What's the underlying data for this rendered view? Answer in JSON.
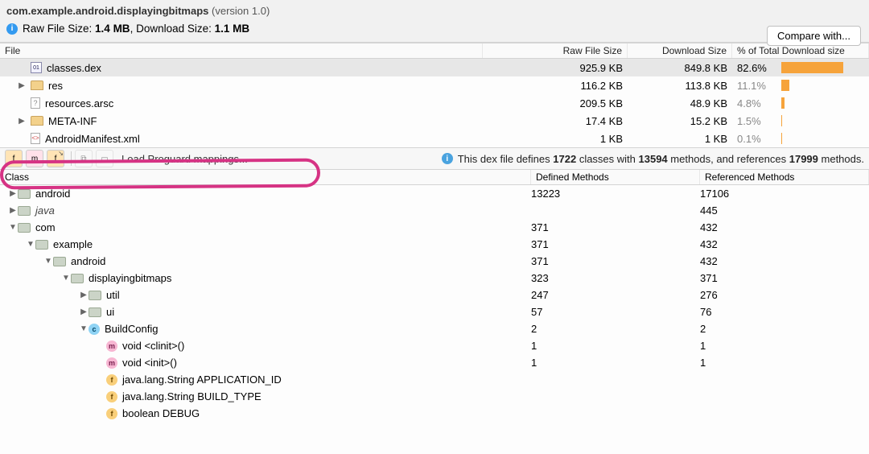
{
  "header": {
    "package": "com.example.android.displayingbitmaps",
    "version_label": "(version 1.0)",
    "raw_label": "Raw File Size:",
    "raw_value": "1.4 MB",
    "dl_label": ", Download Size:",
    "dl_value": "1.1 MB",
    "compare": "Compare with..."
  },
  "file_table": {
    "headers": {
      "file": "File",
      "raw": "Raw File Size",
      "dl": "Download Size",
      "pct": "% of Total Download size"
    },
    "rows": [
      {
        "name": "classes.dex",
        "raw": "925.9 KB",
        "dl": "849.8 KB",
        "pct": "82.6%",
        "bar": 82.6,
        "icon": "dex",
        "arrow": "",
        "selected": true,
        "pad": 26
      },
      {
        "name": "res",
        "raw": "116.2 KB",
        "dl": "113.8 KB",
        "pct": "11.1%",
        "bar": 11.1,
        "icon": "folder",
        "arrow": "▶",
        "pad": 10
      },
      {
        "name": "resources.arsc",
        "raw": "209.5 KB",
        "dl": "48.9 KB",
        "pct": "4.8%",
        "bar": 4.8,
        "icon": "arsc",
        "arrow": "",
        "pad": 26
      },
      {
        "name": "META-INF",
        "raw": "17.4 KB",
        "dl": "15.2 KB",
        "pct": "1.5%",
        "bar": 1.5,
        "icon": "folder",
        "arrow": "▶",
        "pad": 10
      },
      {
        "name": "AndroidManifest.xml",
        "raw": "1 KB",
        "dl": "1 KB",
        "pct": "0.1%",
        "bar": 0.5,
        "icon": "xml",
        "arrow": "",
        "pad": 26
      }
    ]
  },
  "toolbar": {
    "proguard": "Load Proguard mappings...",
    "dex_info_prefix": "This dex file defines",
    "classes": "1722",
    "classes_suffix": "classes with",
    "methods": "13594",
    "methods_suffix": "methods, and references",
    "refs": "17999",
    "refs_suffix": "methods."
  },
  "class_table": {
    "headers": {
      "cls": "Class",
      "def": "Defined Methods",
      "ref": "Referenced Methods"
    },
    "rows": [
      {
        "indent": 0,
        "arrow": "▶",
        "icon": "pkg",
        "label": "android",
        "def": "13223",
        "ref": "17106"
      },
      {
        "indent": 0,
        "arrow": "▶",
        "icon": "pkg",
        "label": "java",
        "italic": true,
        "def": "",
        "ref": "445"
      },
      {
        "indent": 0,
        "arrow": "▼",
        "icon": "pkg",
        "label": "com",
        "def": "371",
        "ref": "432"
      },
      {
        "indent": 1,
        "arrow": "▼",
        "icon": "pkg",
        "label": "example",
        "def": "371",
        "ref": "432"
      },
      {
        "indent": 2,
        "arrow": "▼",
        "icon": "pkg",
        "label": "android",
        "def": "371",
        "ref": "432"
      },
      {
        "indent": 3,
        "arrow": "▼",
        "icon": "pkg",
        "label": "displayingbitmaps",
        "def": "323",
        "ref": "371"
      },
      {
        "indent": 4,
        "arrow": "▶",
        "icon": "pkg",
        "label": "util",
        "def": "247",
        "ref": "276"
      },
      {
        "indent": 4,
        "arrow": "▶",
        "icon": "pkg",
        "label": "ui",
        "def": "57",
        "ref": "76"
      },
      {
        "indent": 4,
        "arrow": "▼",
        "icon": "cls",
        "label": "BuildConfig",
        "def": "2",
        "ref": "2"
      },
      {
        "indent": 5,
        "arrow": "",
        "icon": "m",
        "label": "void <clinit>()",
        "def": "1",
        "ref": "1"
      },
      {
        "indent": 5,
        "arrow": "",
        "icon": "m",
        "label": "void <init>()",
        "def": "1",
        "ref": "1"
      },
      {
        "indent": 5,
        "arrow": "",
        "icon": "f",
        "label": "java.lang.String APPLICATION_ID",
        "def": "",
        "ref": ""
      },
      {
        "indent": 5,
        "arrow": "",
        "icon": "f",
        "label": "java.lang.String BUILD_TYPE",
        "def": "",
        "ref": ""
      },
      {
        "indent": 5,
        "arrow": "",
        "icon": "f",
        "label": "boolean DEBUG",
        "def": "",
        "ref": ""
      }
    ]
  }
}
